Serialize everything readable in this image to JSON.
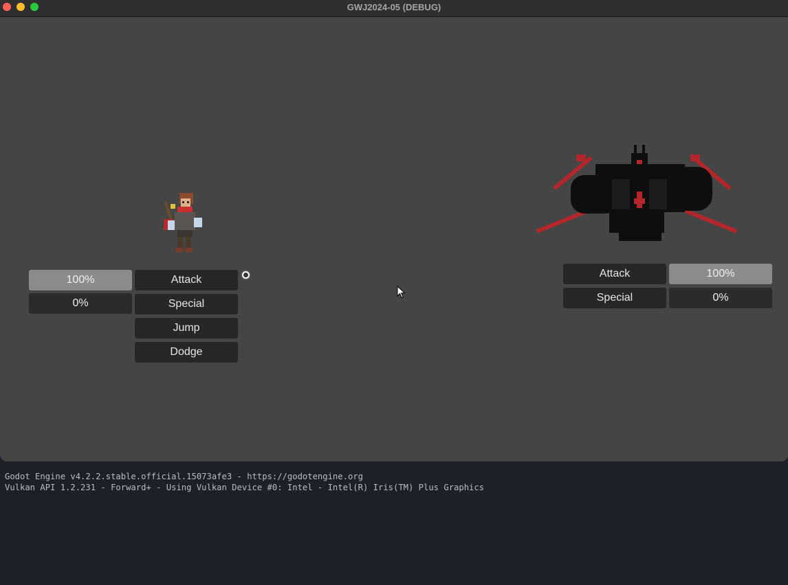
{
  "window": {
    "title": "GWJ2024-05 (DEBUG)"
  },
  "player": {
    "sprite_icon": "hero-sprite",
    "meters": [
      {
        "label": "100%",
        "value": 1.0
      },
      {
        "label": "0%",
        "value": 0.0
      }
    ],
    "actions": [
      "Attack",
      "Special",
      "Jump",
      "Dodge"
    ]
  },
  "enemy": {
    "sprite_icon": "demon-boss-sprite",
    "actions": [
      "Attack",
      "Special"
    ],
    "meters": [
      {
        "label": "100%",
        "value": 1.0
      },
      {
        "label": "0%",
        "value": 0.0
      }
    ]
  },
  "colors": {
    "game_bg": "#454545",
    "button_bg": "#272727",
    "meter_fill": "#8b8b8b",
    "console_bg": "#1d2029",
    "accent_red": "#b3262b"
  },
  "console": {
    "lines": [
      "Godot Engine v4.2.2.stable.official.15073afe3 - https://godotengine.org",
      "Vulkan API 1.2.231 - Forward+ - Using Vulkan Device #0: Intel - Intel(R) Iris(TM) Plus Graphics"
    ]
  }
}
